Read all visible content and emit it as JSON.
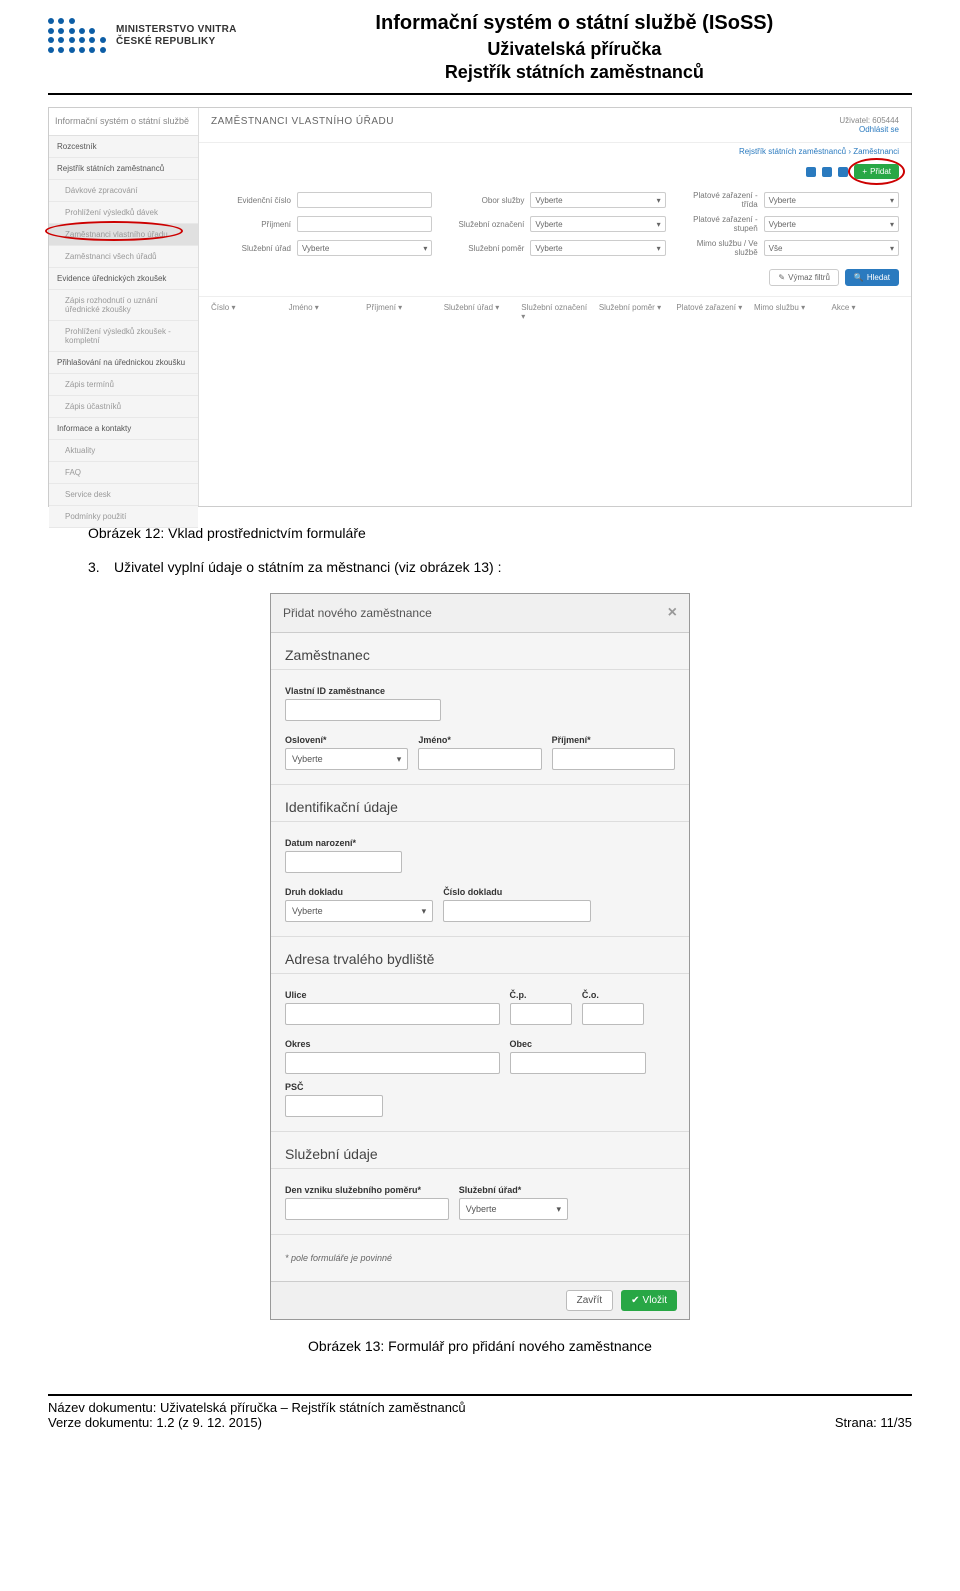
{
  "header": {
    "logo_line1": "MINISTERSTVO VNITRA",
    "logo_line2": "ČESKÉ REPUBLIKY",
    "title1": "Informační systém o státní službě (ISoSS)",
    "title2": "Uživatelská příručka",
    "title3": "Rejstřík státních zaměstnanců"
  },
  "ss1": {
    "brand": "Informační systém o státní službě",
    "user_label": "Uživatel: 605444",
    "logout": "Odhlásit se",
    "topbar_title": "ZAMĚSTNANCI VLASTNÍHO ÚŘADU",
    "breadcrumb": "Rejstřík státních zaměstnanců › Zaměstnanci",
    "add_btn": "Přidat",
    "nav": [
      {
        "label": "Rozcestník",
        "indent": false
      },
      {
        "label": "Rejstřík státních zaměstnanců",
        "indent": false
      },
      {
        "label": "Dávkové zpracování",
        "indent": true
      },
      {
        "label": "Prohlížení výsledků dávek",
        "indent": true
      },
      {
        "label": "Zaměstnanci vlastního úřadu",
        "indent": true,
        "highlight": true
      },
      {
        "label": "Zaměstnanci všech úřadů",
        "indent": true
      },
      {
        "label": "Evidence úřednických zkoušek",
        "indent": false
      },
      {
        "label": "Zápis rozhodnutí o uznání úřednické zkoušky",
        "indent": true
      },
      {
        "label": "Prohlížení výsledků zkoušek - kompletní",
        "indent": true
      },
      {
        "label": "Přihlašování na úřednickou zkoušku",
        "indent": false
      },
      {
        "label": "Zápis termínů",
        "indent": true
      },
      {
        "label": "Zápis účastníků",
        "indent": true
      },
      {
        "label": "Informace a kontakty",
        "indent": false
      },
      {
        "label": "Aktuality",
        "indent": true
      },
      {
        "label": "FAQ",
        "indent": true
      },
      {
        "label": "Service desk",
        "indent": true
      },
      {
        "label": "Podmínky použití",
        "indent": true
      }
    ],
    "filters": {
      "evidencni": "Evidenční číslo",
      "obor": "Obor služby",
      "trida": "Platové zařazení - třída",
      "prijmeni": "Příjmení",
      "oznaceni": "Služební označení",
      "stupen": "Platové zařazení - stupeň",
      "urad": "Služební úřad",
      "pomer": "Služební poměr",
      "mimo": "Mimo službu / Ve službě",
      "vyberte": "Vyberte",
      "vse": "Vše"
    },
    "clear_btn": "Výmaz filtrů",
    "search_btn": "Hledat",
    "table_cols": [
      "Číslo",
      "Jméno",
      "Příjmení",
      "Služební úřad",
      "Služební označení",
      "Služební poměr",
      "Platové zařazení",
      "Mimo službu",
      "Akce"
    ]
  },
  "caption1": "Obrázek 12: Vklad prostřednictvím formuláře",
  "step3_num": "3.",
  "step3_text": "Uživatel vyplní údaje o státním za městnanci (viz obrázek 13) :",
  "ss2": {
    "dialog_title": "Přidat nového zaměstnance",
    "s1": "Zaměstnanec",
    "vlastni_id": "Vlastní ID zaměstnance",
    "osloveni": "Oslovení*",
    "jmeno": "Jméno*",
    "prijmeni": "Příjmení*",
    "vyberte": "Vyberte",
    "s2": "Identifikační údaje",
    "datum_nar": "Datum narození*",
    "druh_dokladu": "Druh dokladu",
    "cislo_dokladu": "Číslo dokladu",
    "s3": "Adresa trvalého bydliště",
    "ulice": "Ulice",
    "cp": "Č.p.",
    "co": "Č.o.",
    "okres": "Okres",
    "obec": "Obec",
    "psc": "PSČ",
    "s4": "Služební údaje",
    "den_vzniku": "Den vzniku služebního poměru*",
    "sluz_urad": "Služební úřad*",
    "note": "* pole formuláře je povinné",
    "close": "Zavřít",
    "save": "Vložit"
  },
  "caption2": "Obrázek 13: Formulář pro přidání nového zaměstnance",
  "footer": {
    "name_label": "Název dokumentu:",
    "name_value": "Uživatelská příručka – Rejstřík státních zaměstnanců",
    "ver_label": "Verze dokumentu:",
    "ver_value": "1.2 (z 9. 12. 2015)",
    "page_label": "Strana:",
    "page_value": "11/35"
  }
}
